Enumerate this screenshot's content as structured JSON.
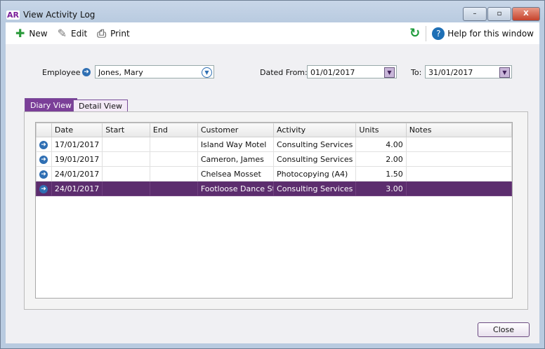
{
  "window": {
    "title": "View Activity Log",
    "logo": "AR",
    "minimize": "▭",
    "restore": "▢",
    "close": "X"
  },
  "toolbar": {
    "new": "New",
    "edit": "Edit",
    "print": "Print",
    "help": "Help for this window"
  },
  "filters": {
    "employee_label": "Employee",
    "employee": "Jones, Mary",
    "from_label": "Dated From:",
    "from": "01/01/2017",
    "to_label": "To:",
    "to": "31/01/2017"
  },
  "tabs": [
    "Diary View",
    "Detail View"
  ],
  "columns": [
    "",
    "Date",
    "Start",
    "End",
    "Customer",
    "Activity",
    "Units",
    "Notes"
  ],
  "rows": [
    [
      "17/01/2017",
      "",
      "",
      "Island Way Motel",
      "Consulting Services",
      "4.00",
      ""
    ],
    [
      "19/01/2017",
      "",
      "",
      "Cameron, James",
      "Consulting Services",
      "2.00",
      ""
    ],
    [
      "24/01/2017",
      "",
      "",
      "Chelsea Mosset",
      "Photocopying (A4)",
      "1.50",
      ""
    ],
    [
      "24/01/2017",
      "",
      "",
      "Footloose Dance Stu",
      "Consulting Services",
      "3.00",
      ""
    ]
  ],
  "selected_row": 3,
  "close_label": "Close",
  "colors": {
    "accent": "#5c2d6e"
  }
}
